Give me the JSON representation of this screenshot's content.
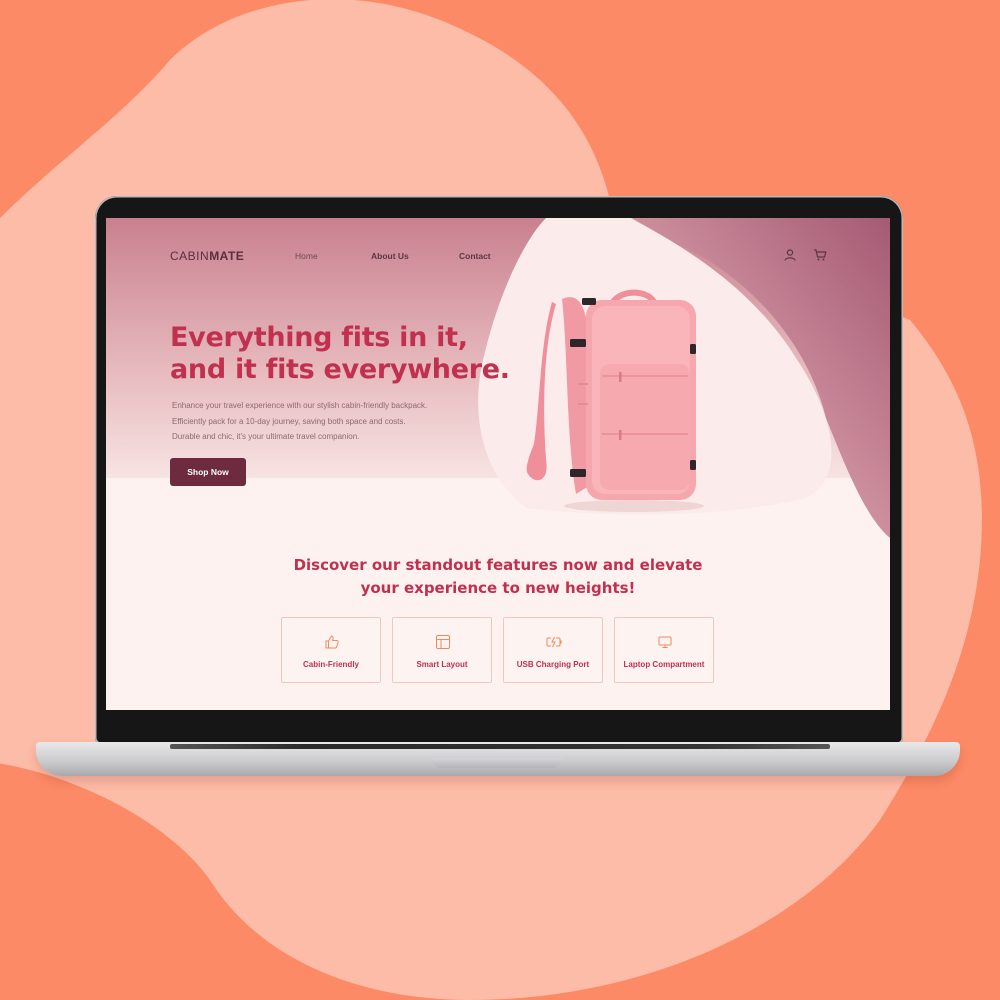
{
  "site": {
    "logo_part1": "CABIN",
    "logo_part2": "MATE"
  },
  "nav": {
    "home": "Home",
    "about": "About Us",
    "contact": "Contact"
  },
  "header_icons": [
    "user-icon",
    "cart-icon"
  ],
  "hero": {
    "headline_line1": "Everything fits in it,",
    "headline_line2": "and it fits everywhere.",
    "desc_line1": "Enhance your travel experience with our stylish cabin-friendly backpack.",
    "desc_line2": "Efficiently pack for a 10-day journey, saving both space and costs.",
    "desc_line3": "Durable and chic, it's your ultimate travel companion.",
    "cta": "Shop Now"
  },
  "features": {
    "title_line1": "Discover our standout features now and elevate",
    "title_line2": "your experience to new heights!",
    "items": [
      {
        "label": "Cabin-Friendly",
        "icon": "thumbs-up-icon"
      },
      {
        "label": "Smart Layout",
        "icon": "layout-icon"
      },
      {
        "label": "USB Charging Port",
        "icon": "battery-charging-icon"
      },
      {
        "label": "Laptop Compartment",
        "icon": "monitor-icon"
      }
    ]
  },
  "colors": {
    "accent": "#c2304f",
    "button": "#6e2b3f",
    "background": "#fd8a66",
    "blob": "#fdbca7",
    "product": "#f6a6ad"
  }
}
